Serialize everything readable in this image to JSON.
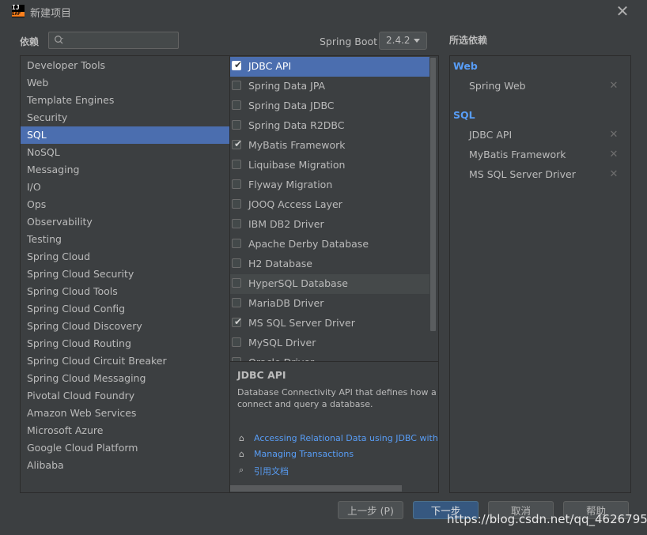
{
  "window": {
    "title": "新建项目",
    "logo_text": "IJ",
    "logo_sub": "EAP"
  },
  "top": {
    "dependencies_label": "依赖",
    "search_placeholder": "",
    "spring_boot_label": "Spring Boot",
    "spring_boot_version": "2.4.2",
    "selected_label": "所选依赖"
  },
  "categories": [
    {
      "label": "Developer Tools",
      "selected": false
    },
    {
      "label": "Web",
      "selected": false
    },
    {
      "label": "Template Engines",
      "selected": false
    },
    {
      "label": "Security",
      "selected": false
    },
    {
      "label": "SQL",
      "selected": true
    },
    {
      "label": "NoSQL",
      "selected": false
    },
    {
      "label": "Messaging",
      "selected": false
    },
    {
      "label": "I/O",
      "selected": false
    },
    {
      "label": "Ops",
      "selected": false
    },
    {
      "label": "Observability",
      "selected": false
    },
    {
      "label": "Testing",
      "selected": false
    },
    {
      "label": "Spring Cloud",
      "selected": false
    },
    {
      "label": "Spring Cloud Security",
      "selected": false
    },
    {
      "label": "Spring Cloud Tools",
      "selected": false
    },
    {
      "label": "Spring Cloud Config",
      "selected": false
    },
    {
      "label": "Spring Cloud Discovery",
      "selected": false
    },
    {
      "label": "Spring Cloud Routing",
      "selected": false
    },
    {
      "label": "Spring Cloud Circuit Breaker",
      "selected": false
    },
    {
      "label": "Spring Cloud Messaging",
      "selected": false
    },
    {
      "label": "Pivotal Cloud Foundry",
      "selected": false
    },
    {
      "label": "Amazon Web Services",
      "selected": false
    },
    {
      "label": "Microsoft Azure",
      "selected": false
    },
    {
      "label": "Google Cloud Platform",
      "selected": false
    },
    {
      "label": "Alibaba",
      "selected": false
    }
  ],
  "dependencies": [
    {
      "label": "JDBC API",
      "checked": true,
      "selected": true
    },
    {
      "label": "Spring Data JPA",
      "checked": false
    },
    {
      "label": "Spring Data JDBC",
      "checked": false
    },
    {
      "label": "Spring Data R2DBC",
      "checked": false
    },
    {
      "label": "MyBatis Framework",
      "checked": true
    },
    {
      "label": "Liquibase Migration",
      "checked": false
    },
    {
      "label": "Flyway Migration",
      "checked": false
    },
    {
      "label": "JOOQ Access Layer",
      "checked": false
    },
    {
      "label": "IBM DB2 Driver",
      "checked": false
    },
    {
      "label": "Apache Derby Database",
      "checked": false
    },
    {
      "label": "H2 Database",
      "checked": false
    },
    {
      "label": "HyperSQL Database",
      "checked": false,
      "hover": true
    },
    {
      "label": "MariaDB Driver",
      "checked": false
    },
    {
      "label": "MS SQL Server Driver",
      "checked": true
    },
    {
      "label": "MySQL Driver",
      "checked": false
    },
    {
      "label": "Oracle Driver",
      "checked": false
    }
  ],
  "description": {
    "title": "JDBC API",
    "text_line1": "Database Connectivity API that defines how a cli",
    "text_line2": "connect and query a database.",
    "links": [
      {
        "icon": "home-icon",
        "label": "Accessing Relational Data using JDBC with Sp"
      },
      {
        "icon": "home-icon",
        "label": "Managing Transactions"
      },
      {
        "icon": "reference-doc-icon",
        "label": "引用文档"
      }
    ]
  },
  "selected_dependencies": [
    {
      "group": "Web",
      "items": [
        "Spring Web"
      ]
    },
    {
      "group": "SQL",
      "items": [
        "JDBC API",
        "MyBatis Framework",
        "MS SQL Server Driver"
      ]
    }
  ],
  "buttons": {
    "previous": "上一步 (P)",
    "next": "下一步",
    "cancel": "取消",
    "help": "帮助"
  },
  "watermark": "https://blog.csdn.net/qq_46267953",
  "colors": {
    "background": "#3c3f41",
    "selection": "#4b6eaf",
    "link": "#589df6",
    "text": "#bbbbbb"
  }
}
